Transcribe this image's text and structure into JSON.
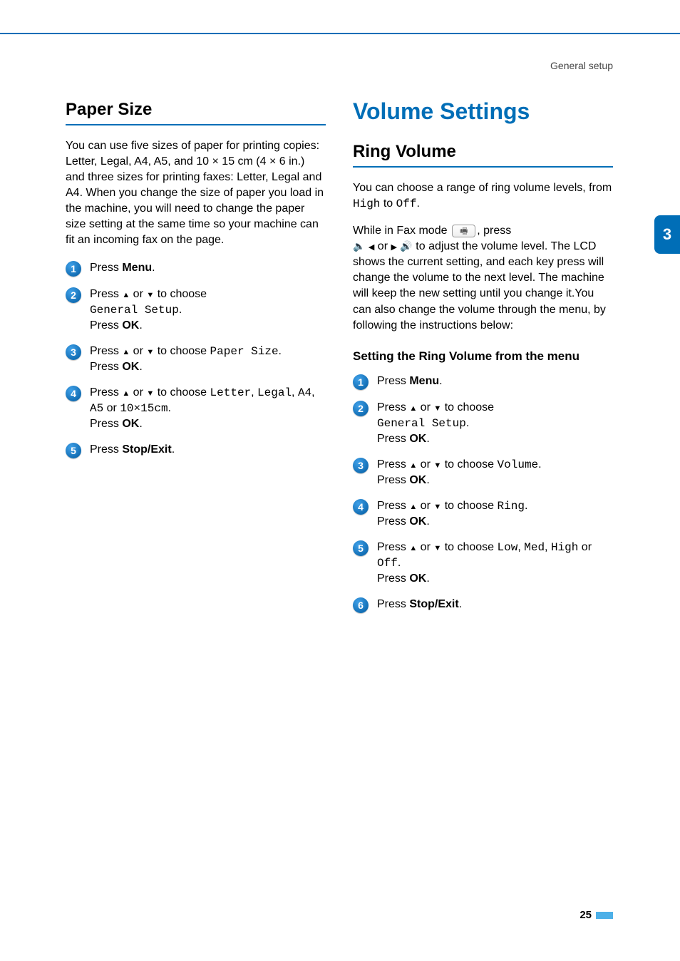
{
  "header": {
    "section": "General setup"
  },
  "chapter": {
    "number": "3"
  },
  "page": {
    "number": "25"
  },
  "left": {
    "h2": "Paper Size",
    "intro": "You can use five sizes of paper for printing copies: Letter, Legal, A4, A5, and 10 × 15 cm (4 × 6 in.) and three sizes for printing faxes: Letter, Legal and A4. When you change the size of paper you load in the machine, you will need to change the paper size setting at the same time so your machine can fit an incoming fax on the page.",
    "steps": [
      {
        "pre": "Press ",
        "bold": "Menu",
        "post": "."
      },
      {
        "line1_pre": "Press ",
        "line1_mid": " or ",
        "line1_post": " to choose",
        "line2_mono": "General Setup",
        "line2_post": ".",
        "line3_pre": "Press ",
        "line3_bold": "OK",
        "line3_post": "."
      },
      {
        "line1_pre": "Press ",
        "line1_mid": " or ",
        "line1_post": " to choose ",
        "line1_mono": "Paper Size",
        "line1_end": ".",
        "line2_pre": "Press ",
        "line2_bold": "OK",
        "line2_post": "."
      },
      {
        "line1_pre": "Press ",
        "line1_mid": " or ",
        "line1_post": " to choose ",
        "opt1": "Letter",
        "c1": ", ",
        "opt2": "Legal",
        "c2": ", ",
        "opt3": "A4",
        "c3": ", ",
        "opt4": "A5",
        "or": " or ",
        "opt5": "10×15cm",
        "end": ".",
        "line3_pre": "Press ",
        "line3_bold": "OK",
        "line3_post": "."
      },
      {
        "pre": "Press ",
        "bold": "Stop/Exit",
        "post": "."
      }
    ]
  },
  "right": {
    "h1": "Volume Settings",
    "h2": "Ring Volume",
    "intro_pre": "You can choose a range of ring volume levels, from ",
    "intro_m1": "High",
    "intro_mid": " to ",
    "intro_m2": "Off",
    "intro_post": ".",
    "p2_a": "While in Fax mode ",
    "p2_b": ", press ",
    "p2_mid": " or ",
    "p2_c": " to adjust the volume level. The LCD shows the current setting, and each key press will change the volume to the next level. The machine will keep the new setting until you change it.You can also change the volume through the menu, by following the instructions below:",
    "sub_h": "Setting the Ring Volume from the menu",
    "steps": [
      {
        "pre": "Press ",
        "bold": "Menu",
        "post": "."
      },
      {
        "line1_pre": "Press ",
        "line1_mid": " or ",
        "line1_post": " to choose",
        "line2_mono": "General Setup",
        "line2_post": ".",
        "line3_pre": "Press ",
        "line3_bold": "OK",
        "line3_post": "."
      },
      {
        "line1_pre": "Press ",
        "line1_mid": " or ",
        "line1_post": " to choose ",
        "line1_mono": "Volume",
        "line1_end": ".",
        "line2_pre": "Press ",
        "line2_bold": "OK",
        "line2_post": "."
      },
      {
        "line1_pre": "Press ",
        "line1_mid": " or ",
        "line1_post": " to choose ",
        "line1_mono": "Ring",
        "line1_end": ".",
        "line2_pre": "Press ",
        "line2_bold": "OK",
        "line2_post": "."
      },
      {
        "line1_pre": "Press ",
        "line1_mid": " or ",
        "line1_post": " to choose ",
        "opt1": "Low",
        "c1": ", ",
        "opt2": "Med",
        "c2": ", ",
        "opt3": "High",
        "or": " or ",
        "opt4": "Off",
        "end": ".",
        "line3_pre": "Press ",
        "line3_bold": "OK",
        "line3_post": "."
      },
      {
        "pre": "Press ",
        "bold": "Stop/Exit",
        "post": "."
      }
    ]
  }
}
